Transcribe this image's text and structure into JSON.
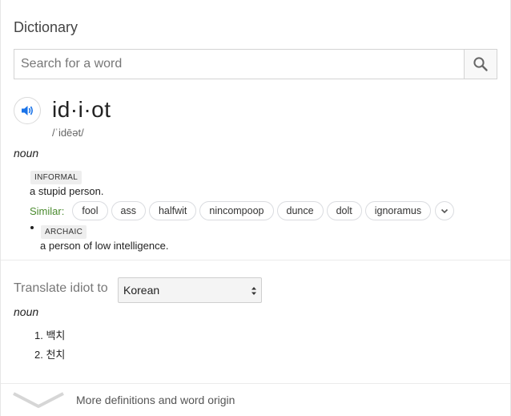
{
  "panel": {
    "title": "Dictionary"
  },
  "search": {
    "placeholder": "Search for a word",
    "value": "",
    "button_icon": "search-icon"
  },
  "entry": {
    "speaker_icon": "speaker-icon",
    "word": "id·i·ot",
    "phonetic": "/ˈidēət/",
    "part_of_speech": "noun",
    "senses": [
      {
        "label": "INFORMAL",
        "definition": "a stupid person.",
        "similar_label": "Similar:",
        "similar": [
          "fool",
          "ass",
          "halfwit",
          "nincompoop",
          "dunce",
          "dolt",
          "ignoramus"
        ],
        "more_icon": "chevron-down-icon"
      },
      {
        "label": "ARCHAIC",
        "definition": "a person of low intelligence."
      }
    ]
  },
  "translate": {
    "label": "Translate idiot to",
    "language": "Korean",
    "part_of_speech": "noun",
    "results": [
      "1.  백치",
      "2.  천치"
    ]
  },
  "footer": {
    "expand_icon": "chevron-down-icon",
    "more_definitions": "More definitions and word origin"
  },
  "colors": {
    "accent_blue": "#1a73e8",
    "similar_green": "#4a8a2e",
    "divider": "#ebebeb"
  }
}
